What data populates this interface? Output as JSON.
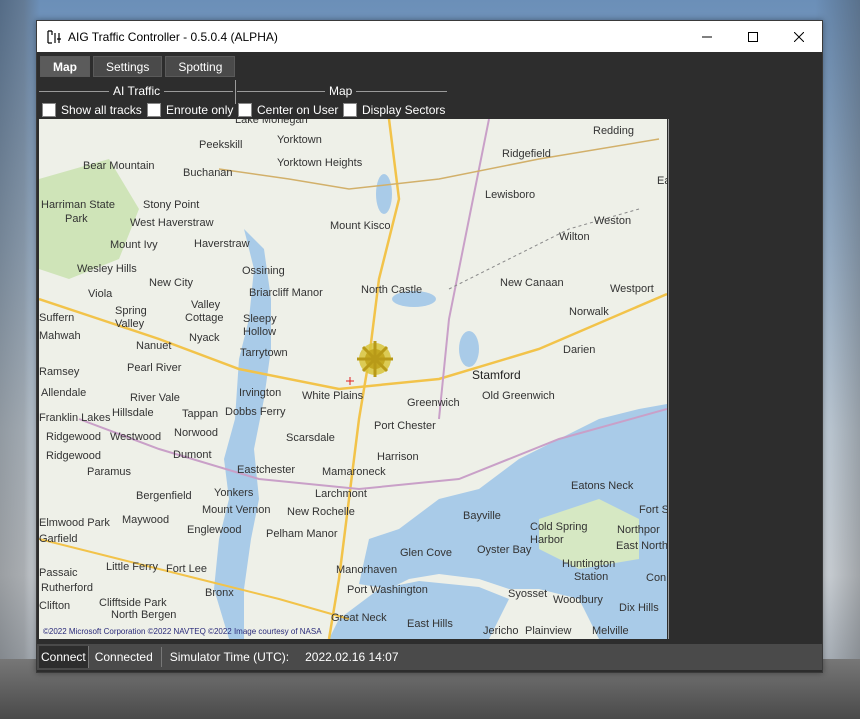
{
  "window": {
    "title": "AIG Traffic Controller - 0.5.0.4 (ALPHA)"
  },
  "tabs": [
    {
      "label": "Map",
      "active": true
    },
    {
      "label": "Settings",
      "active": false
    },
    {
      "label": "Spotting",
      "active": false
    }
  ],
  "ai_traffic": {
    "heading": "AI Traffic",
    "options": [
      {
        "label": "Show all tracks",
        "checked": false
      },
      {
        "label": "Enroute only",
        "checked": false
      }
    ]
  },
  "map_group": {
    "heading": "Map",
    "options": [
      {
        "label": "Center on User",
        "checked": false
      },
      {
        "label": "Display Sectors",
        "checked": false
      }
    ]
  },
  "map": {
    "copyright": "©2022 Microsoft Corporation  ©2022 NAVTEQ  ©2022 Image courtesy of NASA",
    "places": [
      "Lake Mohegan",
      "Yorktown",
      "Peekskill",
      "Redding",
      "Ridgefield",
      "Bear Mountain",
      "Buchanan",
      "Yorktown Heights",
      "Lewisboro",
      "Harriman State Park",
      "Stony Point",
      "West Haverstraw",
      "Mount Kisco",
      "Weston",
      "Mount Ivy",
      "Haverstraw",
      "Wilton",
      "Ossining",
      "Wesley Hills",
      "New City",
      "Briarcliff Manor",
      "North Castle",
      "New Canaan",
      "Westport",
      "Viola",
      "Spring Valley",
      "Valley Cottage",
      "Sleepy Hollow",
      "Norwalk",
      "Suffern",
      "Mahwah",
      "Nyack",
      "Nanuet",
      "Tarrytown",
      "Darien",
      "Ramsey",
      "Pearl River",
      "Allendale",
      "Irvington",
      "White Plains",
      "Stamford",
      "River Vale",
      "Old Greenwich",
      "Hillsdale",
      "Tappan",
      "Dobbs Ferry",
      "Greenwich",
      "Franklin Lakes",
      "Ridgewood",
      "Westwood",
      "Norwood",
      "Port Chester",
      "Scarsdale",
      "Harrison",
      "Ridgewood",
      "Paramus",
      "Dumont",
      "Eastchester",
      "Mamaroneck",
      "Eatons Neck",
      "Bergenfield",
      "Yonkers",
      "Larchmont",
      "Elmwood Park",
      "Maywood",
      "Mount Vernon",
      "New Rochelle",
      "Bayville",
      "Cold Spring Harbor",
      "Fort Salonga",
      "Northport",
      "Garfield",
      "Englewood",
      "Pelham Manor",
      "Glen Cove",
      "Oyster Bay",
      "East Northport",
      "Passaic",
      "Little Ferry",
      "Fort Lee",
      "Manorhaven",
      "Huntington Station",
      "Commack",
      "Rutherford",
      "Bronx",
      "Port Washington",
      "Syosset",
      "Woodbury",
      "Clifton",
      "North Bergen",
      "Dix Hills",
      "Great Neck",
      "East Hills",
      "Jericho",
      "Plainview",
      "Melville",
      "Ea"
    ]
  },
  "status": {
    "connect_label": "Connect",
    "connection_state": "Connected",
    "sim_time_label": "Simulator Time (UTC):",
    "sim_time_value": "2022.02.16 14:07"
  }
}
